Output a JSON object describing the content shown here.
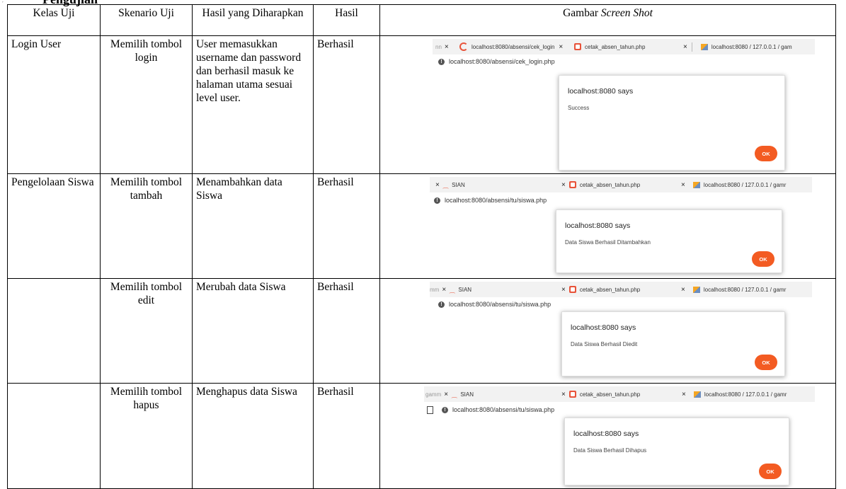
{
  "heading_fragment": "Pengujian",
  "corner_mark": "′",
  "headers": [
    "Kelas Uji",
    "Skenario Uji",
    "Hasil yang Diharapkan",
    "Hasil",
    "Gambar",
    "Screen Shot"
  ],
  "rows": [
    {
      "kelas": "Login User",
      "skenario": "Memilih tombol login",
      "harapan": "User memasukkan username dan password dan berhasil masuk ke halaman utama sesuai level user.",
      "hasil": "Berhasil",
      "shot": {
        "tab0_fragment": "nn",
        "tab1": "localhost:8080/absensi/cek_login",
        "tab2": "cetak_absen_tahun.php",
        "tab3": "localhost:8080 / 127.0.0.1 / gam",
        "url": "localhost:8080/absensi/cek_login.php",
        "dialog_title": "localhost:8080 says",
        "dialog_message": "Success",
        "ok": "OK"
      }
    },
    {
      "kelas": "Pengelolaan Siswa",
      "skenario": "Memilih tombol tambah",
      "harapan": "Menambahkan data Siswa",
      "hasil": "Berhasil",
      "shot": {
        "tab1": "SIAN",
        "tab2": "cetak_absen_tahun.php",
        "tab3": "localhost:8080 / 127.0.0.1 / gamr",
        "url": "localhost:8080/absensi/tu/siswa.php",
        "dialog_title": "localhost:8080 says",
        "dialog_message": "Data Siswa Berhasil Ditambahkan",
        "ok": "OK"
      }
    },
    {
      "kelas": "",
      "skenario": "Memilih tombol edit",
      "harapan": "Merubah data Siswa",
      "hasil": "Berhasil",
      "shot": {
        "tab0_fragment": "mm",
        "tab1": "SIAN",
        "tab2": "cetak_absen_tahun.php",
        "tab3": "localhost:8080 / 127.0.0.1 / gamr",
        "url": "localhost:8080/absensi/tu/siswa.php",
        "dialog_title": "localhost:8080 says",
        "dialog_message": "Data Siswa Berhasil Diedit",
        "ok": "OK"
      }
    },
    {
      "kelas": "",
      "skenario": "Memilih tombol hapus",
      "harapan": "Menghapus data Siswa",
      "hasil": "Berhasil",
      "shot": {
        "tab0_fragment": "gamm",
        "tab1": "SIAN",
        "tab2": "cetak_absen_tahun.php",
        "tab3": "localhost:8080 / 127.0.0.1 / gamr",
        "url": "localhost:8080/absensi/tu/siswa.php",
        "dialog_title": "localhost:8080 says",
        "dialog_message": "Data Siswa Berhasil Dihapus",
        "ok": "OK"
      }
    }
  ]
}
